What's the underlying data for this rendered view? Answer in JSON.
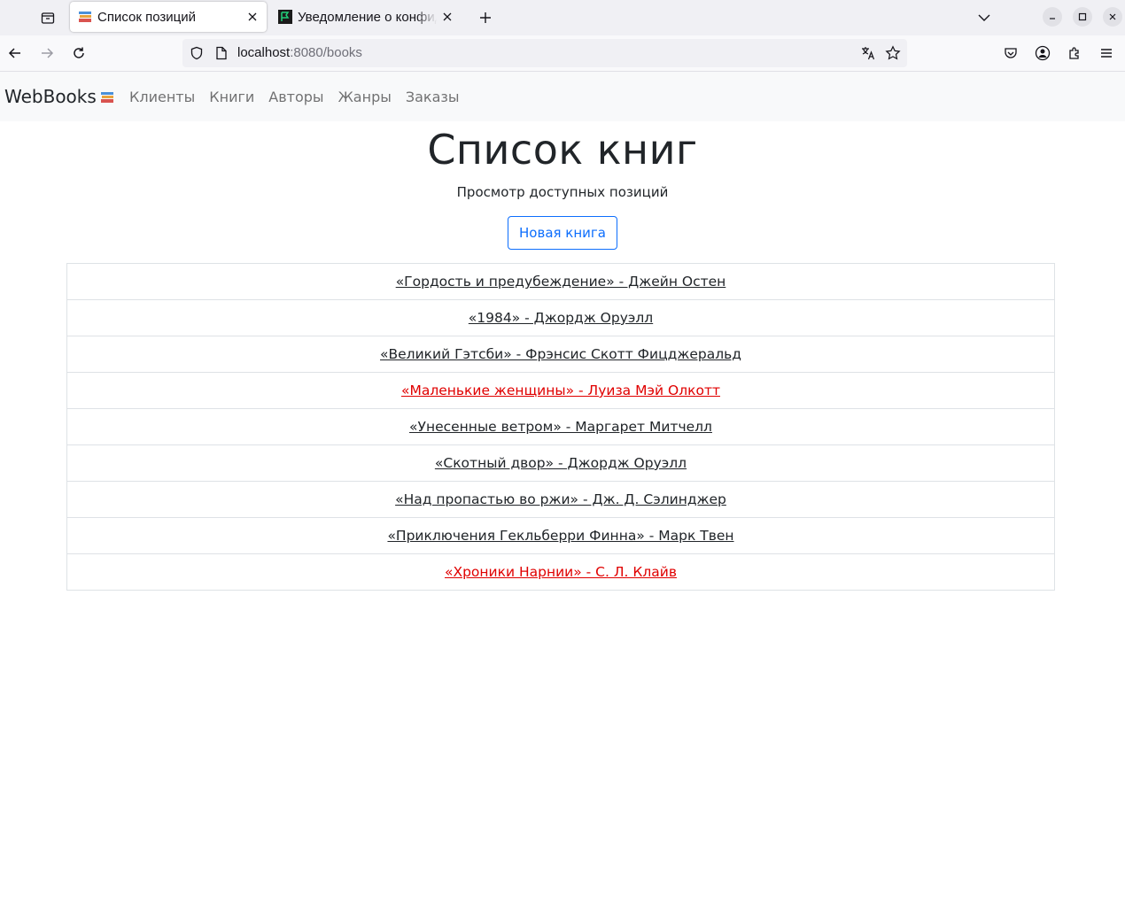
{
  "browser": {
    "tabs": [
      {
        "title": "Список позиций",
        "active": true,
        "favicon": "books-icon"
      },
      {
        "title": "Уведомление о конфиденциальности",
        "active": false,
        "favicon": "terminal-flag-icon"
      }
    ],
    "url": {
      "host": "localhost",
      "rest": ":8080/books"
    }
  },
  "site": {
    "brand": "WebBooks",
    "nav": [
      "Клиенты",
      "Книги",
      "Авторы",
      "Жанры",
      "Заказы"
    ]
  },
  "main": {
    "title": "Список книг",
    "subtitle": "Просмотр доступных позиций",
    "new_button": "Новая книга",
    "books": [
      {
        "text": "«Гордость и предубеждение» - Джейн Остен",
        "color": "#212529"
      },
      {
        "text": "«1984» - Джордж Оруэлл",
        "color": "#212529"
      },
      {
        "text": "«Великий Гэтсби» - Фрэнсис Скотт Фицджеральд",
        "color": "#212529"
      },
      {
        "text": "«Маленькие женщины» - Луиза Мэй Олкотт",
        "color": "#e00000"
      },
      {
        "text": "«Унесенные ветром» - Маргарет Митчелл",
        "color": "#212529"
      },
      {
        "text": "«Скотный двор» - Джордж Оруэлл",
        "color": "#212529"
      },
      {
        "text": "«Над пропастью во ржи» - Дж. Д. Сэлинджер",
        "color": "#212529"
      },
      {
        "text": "«Приключения Гекльберри Финна» - Марк Твен",
        "color": "#212529"
      },
      {
        "text": "«Хроники Нарнии» - С. Л. Клайв",
        "color": "#e00000"
      }
    ]
  },
  "colors": {
    "accent": "#0d6efd",
    "highlight": "#e00000"
  }
}
